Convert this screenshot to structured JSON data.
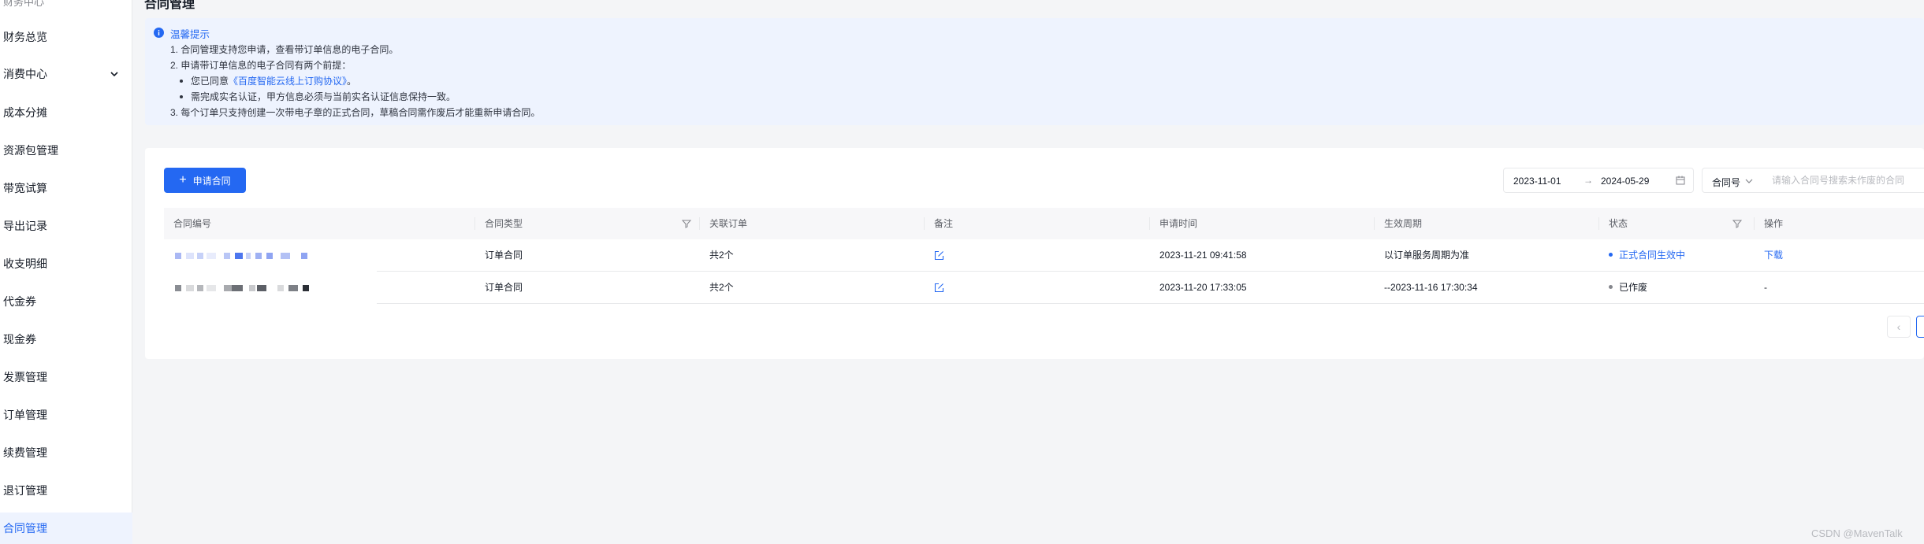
{
  "sidebar": {
    "cutoff_label": "财务中心",
    "items": [
      {
        "label": "财务总览"
      },
      {
        "label": "消费中心"
      },
      {
        "label": "成本分摊"
      },
      {
        "label": "资源包管理"
      },
      {
        "label": "带宽试算"
      },
      {
        "label": "导出记录"
      },
      {
        "label": "收支明细"
      },
      {
        "label": "代金券"
      },
      {
        "label": "现金券"
      },
      {
        "label": "发票管理"
      },
      {
        "label": "订单管理"
      },
      {
        "label": "续费管理"
      },
      {
        "label": "退订管理"
      },
      {
        "label": "合同管理"
      }
    ]
  },
  "page": {
    "title": "合同管理"
  },
  "tip": {
    "title": "温馨提示",
    "line1": "1. 合同管理支持您申请，查看带订单信息的电子合同。",
    "line2": "2. 申请带订单信息的电子合同有两个前提：",
    "bullet1_prefix": "您已同意",
    "bullet1_link": "《百度智能云线上订购协议》",
    "bullet1_suffix": "。",
    "bullet2": "需完成实名认证，甲方信息必须与当前实名认证信息保持一致。",
    "line3": "3. 每个订单只支持创建一次带电子章的正式合同，草稿合同需作废后才能重新申请合同。"
  },
  "toolbar": {
    "apply_label": "申请合同",
    "date_start": "2023-11-01",
    "date_arrow": "→",
    "date_end": "2024-05-29",
    "select_value": "合同号",
    "search_placeholder": "请输入合同号搜索未作废的合同"
  },
  "table": {
    "headers": {
      "contract_no": "合同编号",
      "contract_type": "合同类型",
      "related_order": "关联订单",
      "remark": "备注",
      "apply_time": "申请时间",
      "effective_period": "生效周期",
      "status": "状态",
      "action": "操作"
    },
    "rows": [
      {
        "contract_type": "订单合同",
        "related_order": "共2个",
        "apply_time": "2023-11-21 09:41:58",
        "effective_period": "以订单服务周期为准",
        "status": "正式合同生效中",
        "status_color": "#2468f2",
        "action": "下载"
      },
      {
        "contract_type": "订单合同",
        "related_order": "共2个",
        "apply_time": "2023-11-20 17:33:05",
        "effective_period": "--2023-11-16 17:30:34",
        "status": "已作废",
        "status_color": "#84868c",
        "action": "-"
      }
    ]
  },
  "pager": {
    "prev_symbol": "‹"
  },
  "watermark": "CSDN @MavenTalk",
  "colors": {
    "accent": "#2468f2",
    "tip_bg": "#eef3fe"
  }
}
